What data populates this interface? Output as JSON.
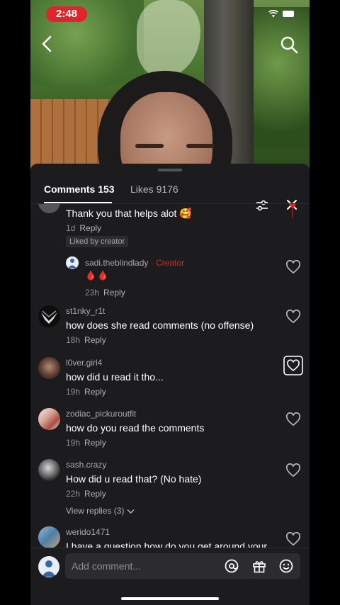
{
  "status": {
    "time": "2:48"
  },
  "tabs": {
    "comments": "Comments 153",
    "likes": "Likes 9176"
  },
  "comments": [
    {
      "text": "Thank you that helps alot 🥰",
      "time": "1d",
      "reply": "Reply",
      "badge": "Liked by creator"
    },
    {
      "username": "sadi.theblindlady",
      "creator_sep": "·",
      "creator_label": "Creator",
      "text": "🩸🩸",
      "time": "23h",
      "reply": "Reply"
    },
    {
      "username": "st1nky_r1t",
      "text": "how does she read comments (no offense)",
      "time": "18h",
      "reply": "Reply"
    },
    {
      "username": "l0ver.girl4",
      "text": "how did u read it tho...",
      "time": "19h",
      "reply": "Reply"
    },
    {
      "username": "zodiac_pickuroutfit",
      "text": "how do you read the comments",
      "time": "19h",
      "reply": "Reply"
    },
    {
      "username": "sash.crazy",
      "text": "How did u read that? (No hate)",
      "time": "22h",
      "reply": "Reply",
      "view_replies": "View replies (3)"
    },
    {
      "username": "werido1471",
      "text": "I have a question how do you get around your"
    }
  ],
  "composer": {
    "placeholder": "Add comment..."
  },
  "colors": {
    "accent": "#e1242c",
    "sheet": "#1c1c1e"
  },
  "icons": [
    "back-icon",
    "search-icon",
    "filter-icon",
    "close-icon",
    "heart-icon",
    "at-icon",
    "gift-icon",
    "emoji-icon"
  ]
}
